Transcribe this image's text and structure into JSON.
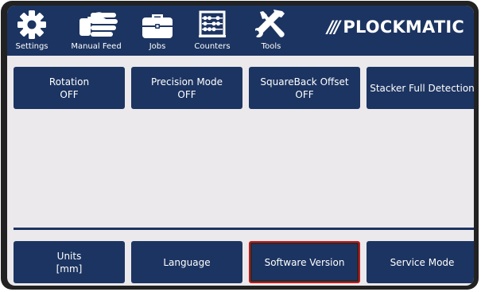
{
  "nav": {
    "items": [
      {
        "label": "Settings",
        "icon": "gear-icon"
      },
      {
        "label": "Manual Feed",
        "icon": "hand-icon"
      },
      {
        "label": "Jobs",
        "icon": "briefcase-icon"
      },
      {
        "label": "Counters",
        "icon": "abacus-icon"
      },
      {
        "label": "Tools",
        "icon": "wrench-screwdriver-icon"
      }
    ],
    "brand": "PLOCKMATIC",
    "brand_slashes": "///"
  },
  "options_top": [
    {
      "title": "Rotation",
      "value": "OFF"
    },
    {
      "title": "Precision Mode",
      "value": "OFF"
    },
    {
      "title": "SquareBack Offset",
      "value": "OFF"
    },
    {
      "title": "Stacker Full Detection",
      "value": ""
    }
  ],
  "options_bottom": [
    {
      "title": "Units",
      "value": "[mm]"
    },
    {
      "title": "Language",
      "value": ""
    },
    {
      "title": "Software Version",
      "value": ""
    },
    {
      "title": "Service Mode",
      "value": ""
    }
  ],
  "colors": {
    "primary": "#1c3461",
    "background": "#ece9ec",
    "selected_border": "#c0191d"
  }
}
